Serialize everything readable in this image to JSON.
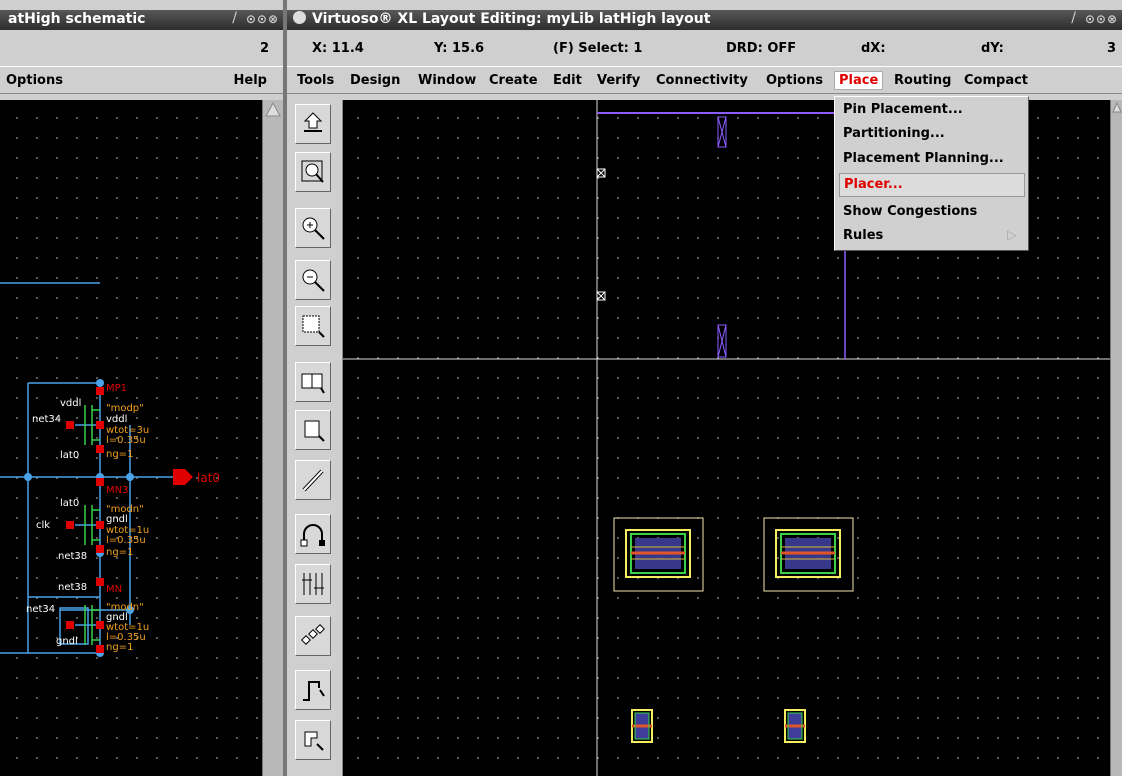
{
  "window_left": {
    "title": "atHigh schematic",
    "controls": "⊙⊙⊗",
    "status_number": "2",
    "menu": {
      "options": "Options",
      "help": "Help"
    }
  },
  "window_right": {
    "title": "Virtuoso® XL Layout Editing: myLib latHigh layout",
    "controls": "⊙⊙⊗",
    "status": {
      "x": "X: 11.4",
      "y": "Y: 15.6",
      "select": "(F) Select: 1",
      "drd": "DRD: OFF",
      "dx": "dX:",
      "dy": "dY:",
      "number": "3"
    },
    "menu": [
      "Tools",
      "Design",
      "Window",
      "Create",
      "Edit",
      "Verify",
      "Connectivity",
      "Options",
      "Place",
      "Routing",
      "Compact"
    ],
    "active_menu": "Place",
    "place_menu": [
      "Pin Placement...",
      "Partitioning...",
      "Placement Planning...",
      "Placer...",
      "Show Congestions",
      "Rules"
    ],
    "highlighted_item": "Placer...",
    "toolbar_icons": [
      "save-icon",
      "zoom-fit-icon",
      "zoom-in-icon",
      "zoom-out-icon",
      "select-area-icon",
      "stretch-icon",
      "copy-icon",
      "path-icon",
      "undo-arc-icon",
      "align-icon",
      "rotate-icon",
      "route-icon",
      "move-icon"
    ]
  },
  "schematic": {
    "labels": {
      "mp1": "MP1",
      "modp": "\"modp\"",
      "vdd_left": "vddl",
      "vdd_right": "vddl",
      "net34_a": "net34",
      "wtot_mp": "wtot=3u",
      "l_mp": "l=0.35u",
      "ng_mp": "ng=1",
      "lat0_a": "lat0",
      "lat0_pin": "lat0",
      "mn3": "MN3",
      "lat0_b": "lat0",
      "modn_a": "\"modn\"",
      "clk": "clk",
      "gnd_a": "gndl",
      "wtot_mn3": "wtot=1u",
      "l_mn3": "l=0.35u",
      "net38_a": "net38",
      "ng_mn3": "ng=1",
      "net38_b": "net38",
      "mn": "MN",
      "modn_b": "\"modn\"",
      "net34_b": "net34",
      "gnd_b": "gndl",
      "wtot_mn": "wtot=1u",
      "l_mn": "l=0.35u",
      "gnd_c": "gndl",
      "ng_mn": "ng=1"
    }
  },
  "colors": {
    "accent_red": "#e00000",
    "wire_blue": "#4aa3e8",
    "layout_purple": "#8c5cff",
    "layout_yellow": "#f5ee60",
    "layout_green": "#39d14a"
  }
}
